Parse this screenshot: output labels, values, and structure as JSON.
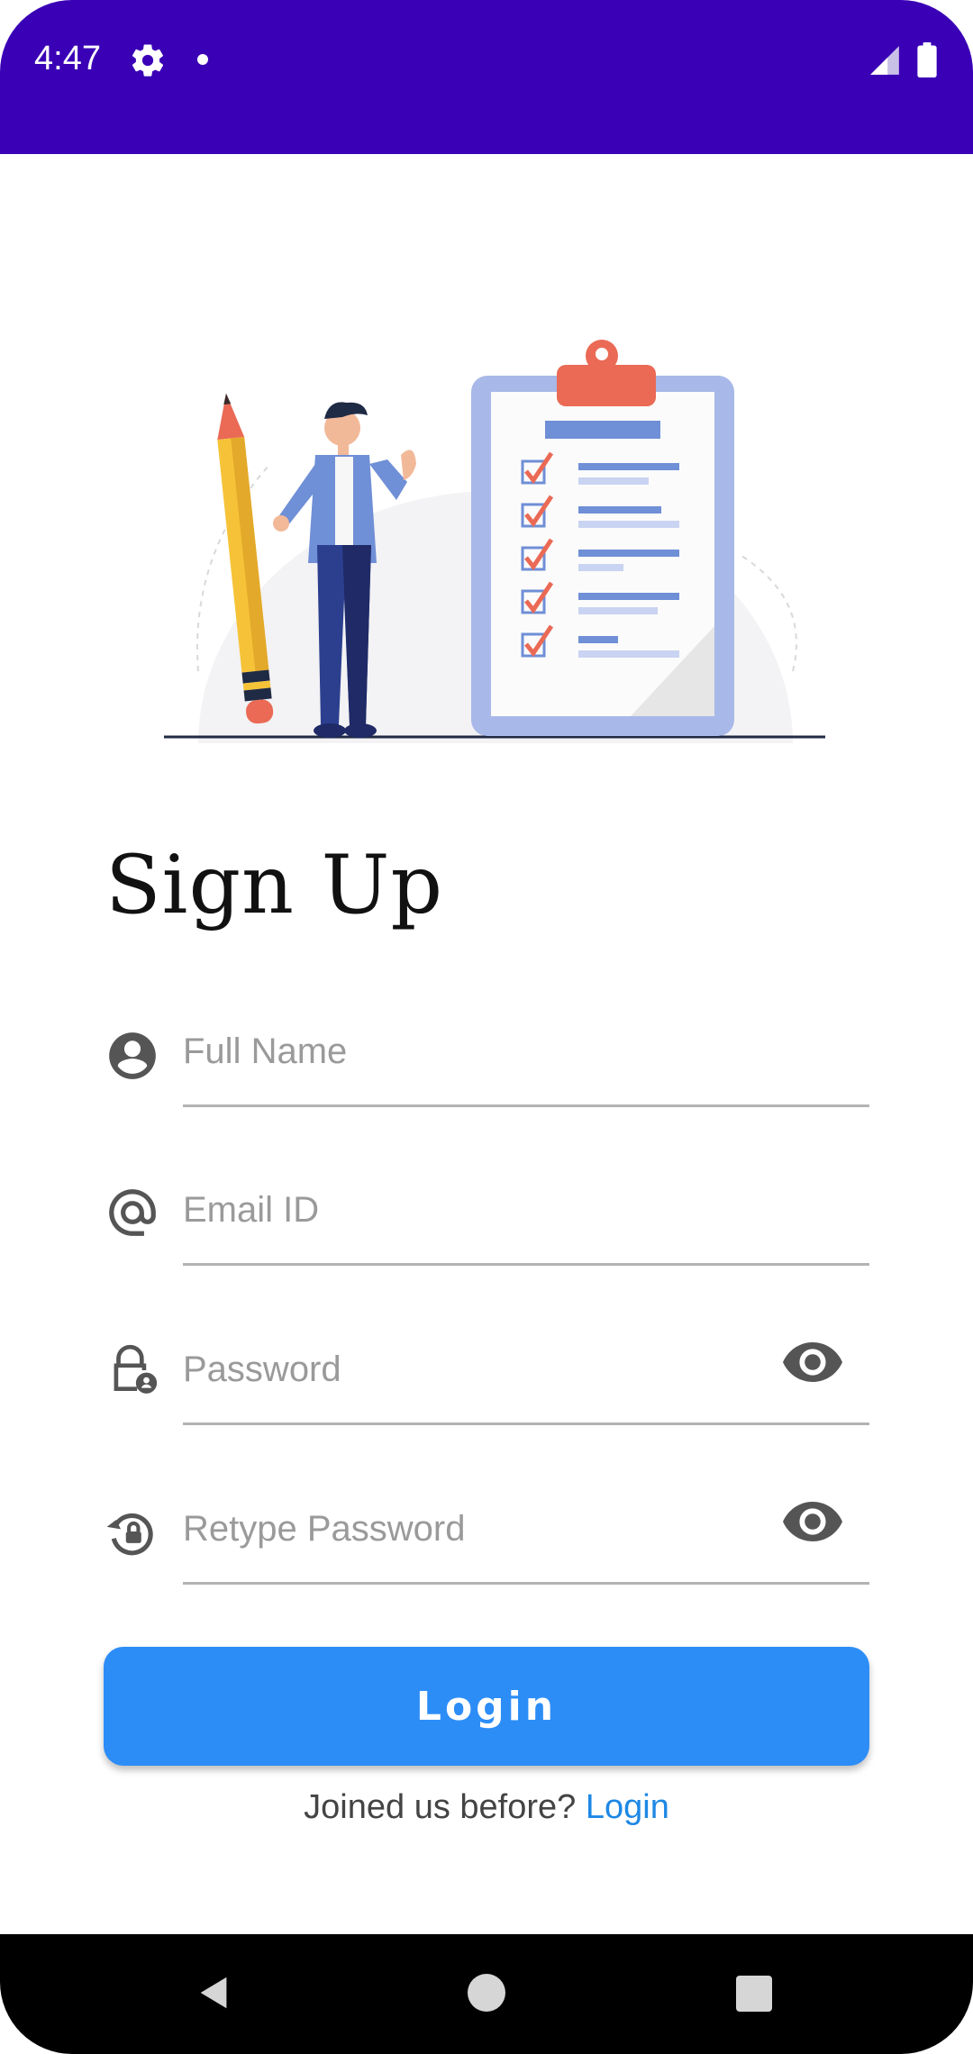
{
  "status_bar": {
    "time": "4:47",
    "icons": [
      "gear-icon",
      "notification-dot-icon",
      "signal-icon",
      "battery-icon"
    ],
    "color": "#3a00b6"
  },
  "illustration": {
    "description_icon": "signup-checklist-illustration"
  },
  "page": {
    "title": "Sign Up"
  },
  "form": {
    "full_name": {
      "placeholder": "Full Name",
      "value": "",
      "icon": "account-circle-icon"
    },
    "email": {
      "placeholder": "Email ID",
      "value": "",
      "icon": "at-sign-icon"
    },
    "password": {
      "placeholder": "Password",
      "value": "",
      "icon": "lock-person-icon",
      "toggle_icon": "eye-icon"
    },
    "retype_password": {
      "placeholder": "Retype Password",
      "value": "",
      "icon": "lock-reset-icon",
      "toggle_icon": "eye-icon"
    },
    "submit_label": "Login"
  },
  "footer": {
    "prompt": "Joined us before? ",
    "link_label": "Login"
  },
  "colors": {
    "accent": "#2d8df7",
    "link": "#1e88e5"
  },
  "nav_bar": {
    "icons": [
      "back-icon",
      "home-icon",
      "recents-icon"
    ]
  }
}
